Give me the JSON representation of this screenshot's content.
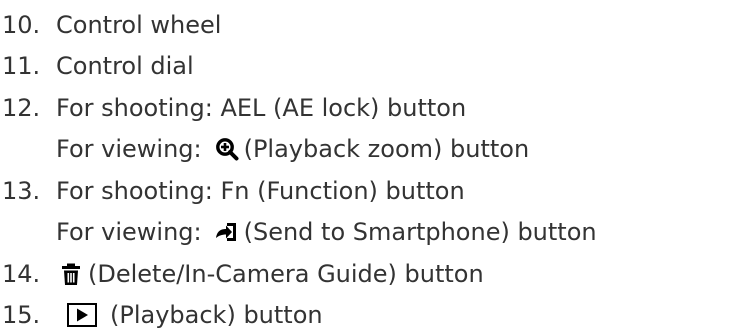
{
  "items": [
    {
      "number": "10.",
      "text": "Control wheel"
    },
    {
      "number": "11.",
      "text": "Control dial"
    },
    {
      "number": "12.",
      "text": "For shooting: AEL (AE lock) button"
    },
    {
      "number": "",
      "prefix": "For viewing:",
      "icon": "zoom-in-icon",
      "suffix": "(Playback zoom) button"
    },
    {
      "number": "13.",
      "text": "For shooting: Fn (Function) button"
    },
    {
      "number": "",
      "prefix": "For viewing:",
      "icon": "send-to-smartphone-icon",
      "suffix": "(Send to Smartphone) button"
    },
    {
      "number": "14.",
      "icon": "trash-icon",
      "suffix": "(Delete/In-Camera Guide) button"
    },
    {
      "number": "15.",
      "icon": "playback-icon",
      "suffix": "(Playback) button"
    }
  ],
  "colors": {
    "text": "#333333",
    "icon": "#000000"
  }
}
